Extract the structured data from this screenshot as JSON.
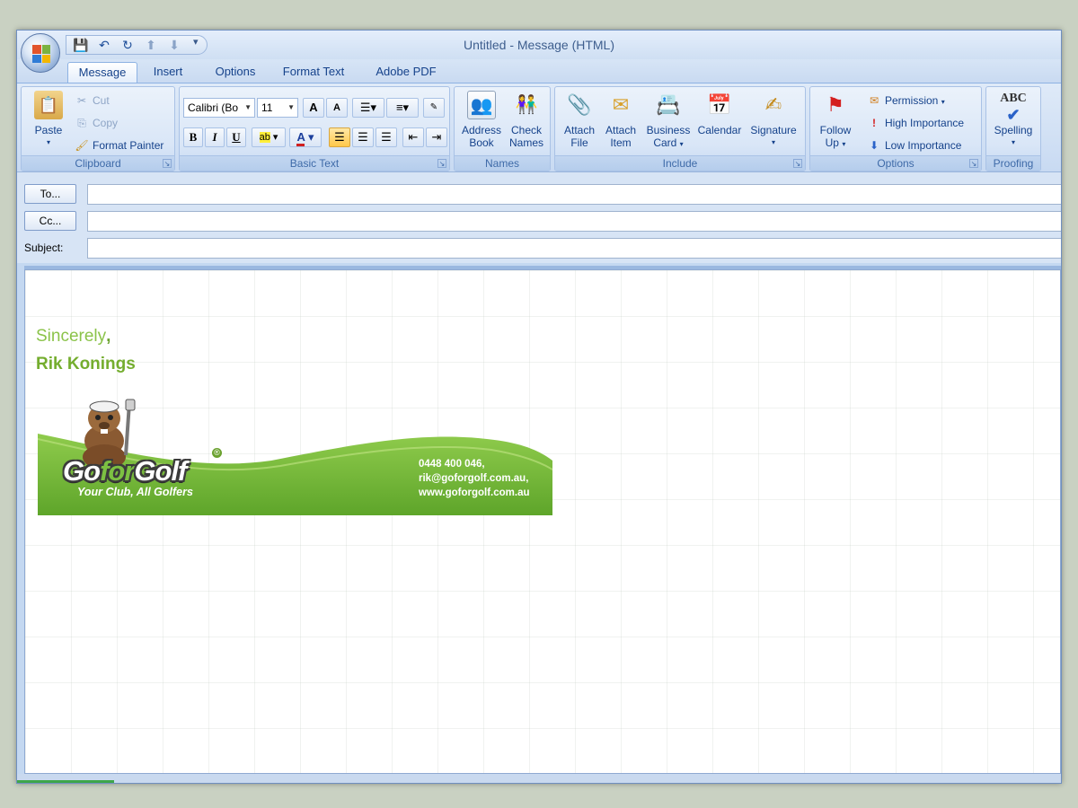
{
  "window": {
    "title": "Untitled - Message (HTML)"
  },
  "qat": {
    "icons": [
      "save-icon",
      "undo-icon",
      "redo-icon",
      "up-arrow-icon",
      "down-arrow-icon"
    ],
    "more": "▾"
  },
  "tabs": [
    "Message",
    "Insert",
    "Options",
    "Format Text",
    "Adobe PDF"
  ],
  "ribbon": {
    "clipboard": {
      "label": "Clipboard",
      "paste": "Paste",
      "cut": "Cut",
      "copy": "Copy",
      "format_painter": "Format Painter"
    },
    "basic_text": {
      "label": "Basic Text",
      "font_name": "Calibri (Bo",
      "font_size": "11",
      "grow": "A",
      "shrink": "A",
      "bold": "B",
      "italic": "I",
      "underline": "U",
      "highlight": "ab",
      "font_color": "A"
    },
    "names": {
      "label": "Names",
      "address_book_1": "Address",
      "address_book_2": "Book",
      "check_names_1": "Check",
      "check_names_2": "Names"
    },
    "include": {
      "label": "Include",
      "attach_file_1": "Attach",
      "attach_file_2": "File",
      "attach_item_1": "Attach",
      "attach_item_2": "Item",
      "business_card_1": "Business",
      "business_card_2": "Card",
      "calendar": "Calendar",
      "signature": "Signature"
    },
    "options": {
      "label": "Options",
      "follow_up_1": "Follow",
      "follow_up_2": "Up",
      "permission": "Permission",
      "high_importance": "High Importance",
      "low_importance": "Low Importance"
    },
    "proofing": {
      "label": "Proofing",
      "spelling": "Spelling",
      "abc": "ABC"
    }
  },
  "headers": {
    "to_button": "To...",
    "cc_button": "Cc...",
    "subject_label": "Subject:",
    "to_value": "",
    "cc_value": "",
    "subject_value": ""
  },
  "body": {
    "closing": "Sincerely",
    "closing_comma": ",",
    "name": "Rik Konings",
    "signature": {
      "brand_go": "Go",
      "brand_for": "for",
      "brand_golf": "Golf",
      "registered": "®",
      "tagline": "Your Club, All Golfers",
      "phone": "0448 400 046,",
      "email": "rik@goforgolf.com.au,",
      "website": "www.goforgolf.com.au"
    }
  },
  "colors": {
    "signature_green": "#8bc34a",
    "banner_green": "#6aa12e",
    "ribbon_blue": "#c4d8f1"
  }
}
